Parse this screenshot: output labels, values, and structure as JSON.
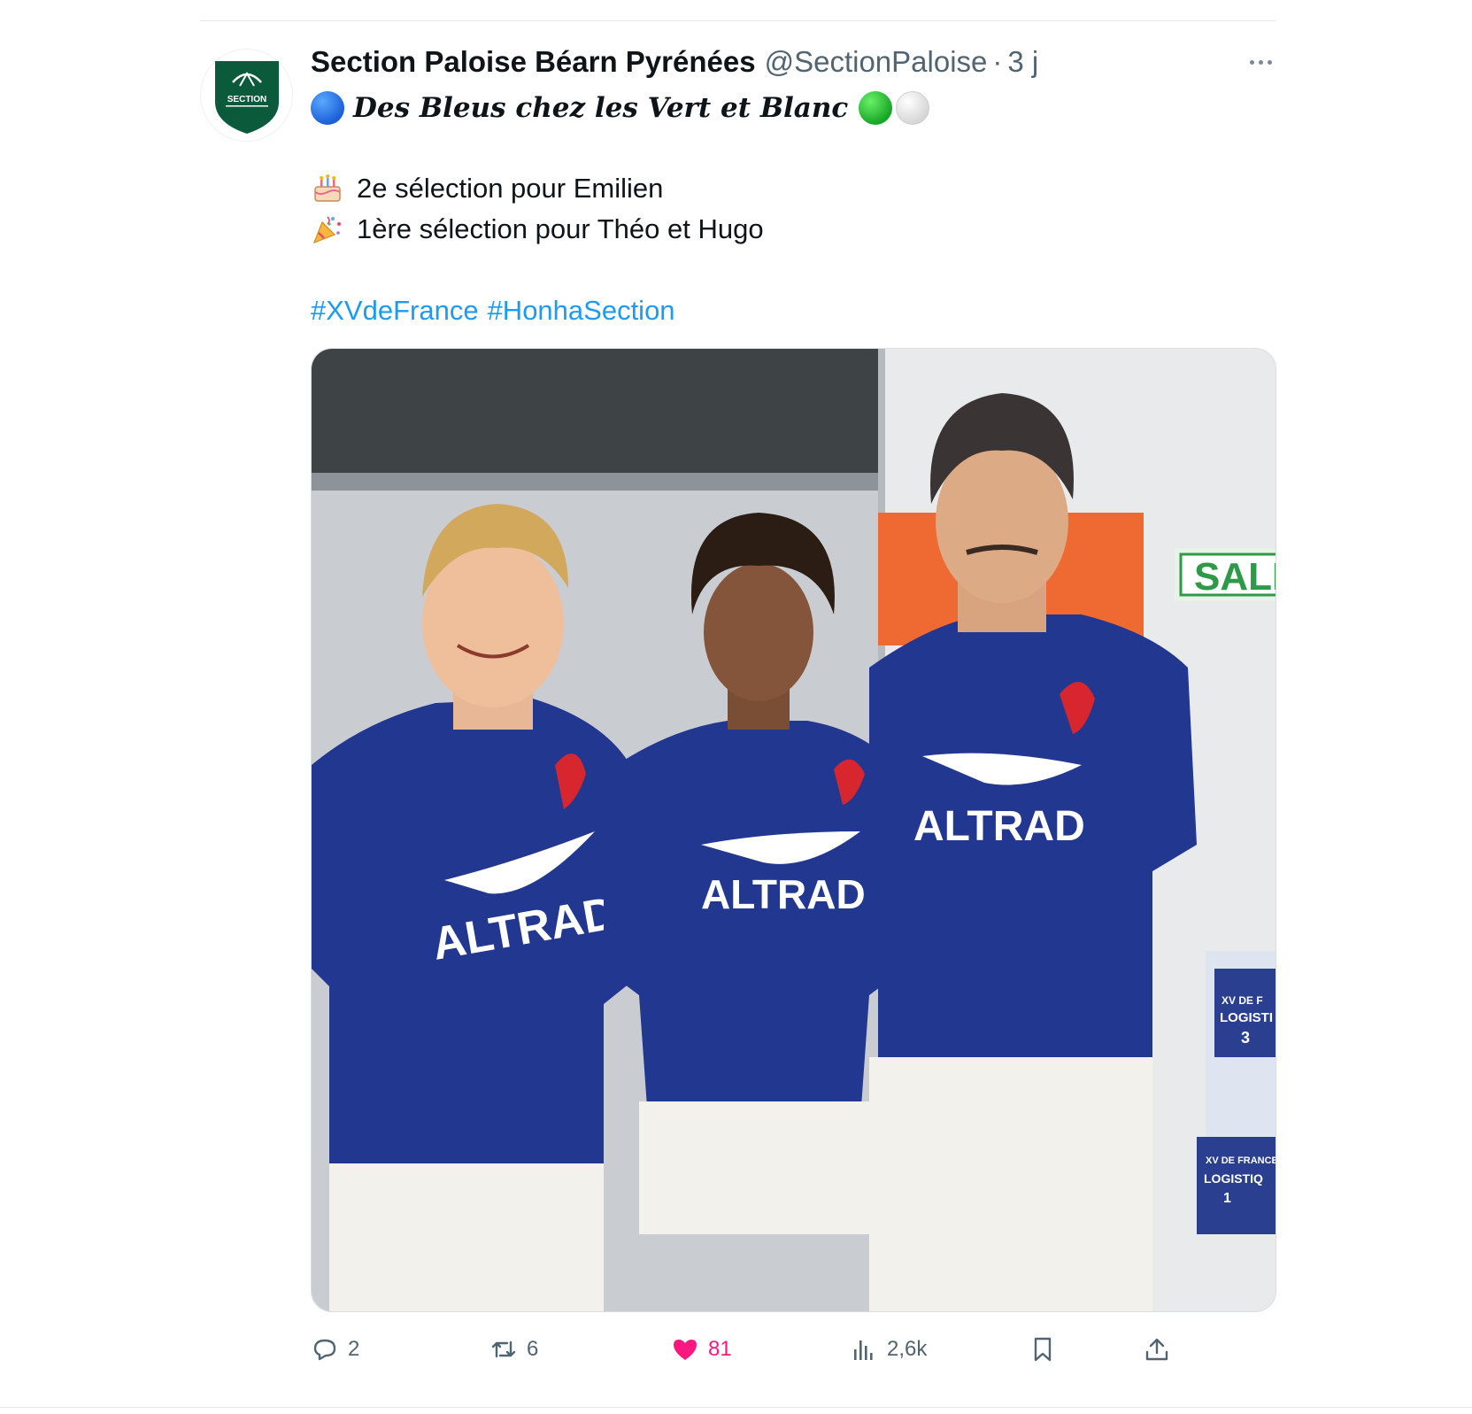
{
  "tweet": {
    "display_name": "Section Paloise Béarn Pyrénées",
    "handle": "@SectionPaloise",
    "separator": "·",
    "time": "3 j",
    "headline": "Des Bleus chez les Vert et Blanc",
    "lines": [
      {
        "emoji": "birthday-cake-icon",
        "text": "2e sélection pour Emilien"
      },
      {
        "emoji": "party-popper-icon",
        "text": "1ère sélection pour Théo et Hugo"
      }
    ],
    "hashtags": [
      "#XVdeFrance",
      "#HonhaSection"
    ],
    "avatar_text": "SECTION"
  },
  "media": {
    "description_icon": "photo",
    "jersey_sponsor": "ALTRAD",
    "sign_text": "SALID",
    "box_labels": [
      "XV DE F",
      "LOGISTI",
      "3",
      "XV DE FRANCE",
      "LOGISTIQ",
      "1"
    ]
  },
  "actions": {
    "replies": "2",
    "reposts": "6",
    "likes": "81",
    "views": "2,6k"
  },
  "colors": {
    "link": "#1d9bf0",
    "like": "#f91880",
    "secondary_text": "#536471",
    "club_green": "#0b5a3c",
    "jersey_blue": "#22378f"
  }
}
